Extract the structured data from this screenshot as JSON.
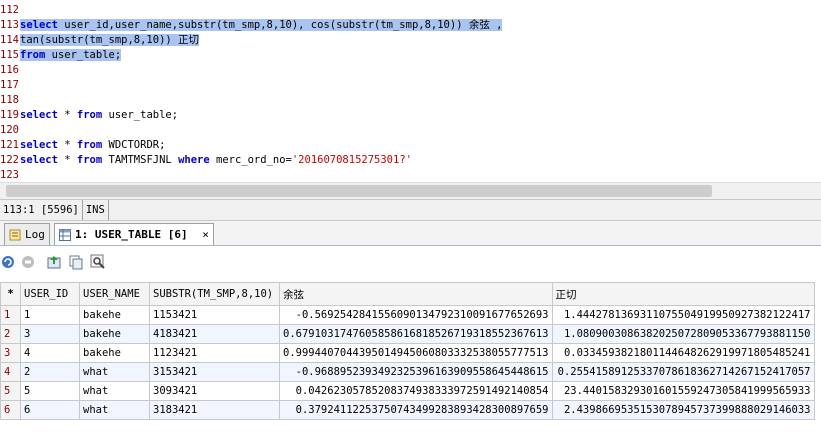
{
  "editor": {
    "lines": [
      {
        "num": "112",
        "parts": []
      },
      {
        "num": "113",
        "sel": true,
        "parts": [
          {
            "t": "kw",
            "v": "select"
          },
          {
            "t": "tx",
            "v": " user_id,user_name,substr(tm_smp,8,10), cos(substr(tm_smp,8,10)) 余弦 ,"
          }
        ]
      },
      {
        "num": "114",
        "sel": true,
        "parts": [
          {
            "t": "tx",
            "v": "tan(substr(tm_smp,8,10)) 正切"
          }
        ]
      },
      {
        "num": "115",
        "sel": true,
        "parts": [
          {
            "t": "kw",
            "v": "from"
          },
          {
            "t": "tx",
            "v": " user_table;"
          }
        ]
      },
      {
        "num": "116",
        "parts": []
      },
      {
        "num": "117",
        "parts": []
      },
      {
        "num": "118",
        "parts": []
      },
      {
        "num": "119",
        "parts": [
          {
            "t": "kw",
            "v": "select"
          },
          {
            "t": "tx",
            "v": " * "
          },
          {
            "t": "kw",
            "v": "from"
          },
          {
            "t": "tx",
            "v": " user_table;"
          }
        ]
      },
      {
        "num": "120",
        "parts": []
      },
      {
        "num": "121",
        "parts": [
          {
            "t": "kw",
            "v": "select"
          },
          {
            "t": "tx",
            "v": " * "
          },
          {
            "t": "kw",
            "v": "from"
          },
          {
            "t": "tx",
            "v": " WDCTORDR;"
          }
        ]
      },
      {
        "num": "122",
        "parts": [
          {
            "t": "kw",
            "v": "select"
          },
          {
            "t": "tx",
            "v": " * "
          },
          {
            "t": "kw",
            "v": "from"
          },
          {
            "t": "tx",
            "v": " TAMTMSFJNL "
          },
          {
            "t": "kw",
            "v": "where"
          },
          {
            "t": "tx",
            "v": " merc_ord_no="
          },
          {
            "t": "str",
            "v": "'2016070815275301?'"
          }
        ]
      },
      {
        "num": "123",
        "parts": []
      }
    ]
  },
  "status": {
    "position": "113:1 [5596]",
    "mode": "INS"
  },
  "tabs": {
    "log": "Log",
    "result": "1: USER_TABLE [6]",
    "close": "×"
  },
  "grid": {
    "star": "*",
    "headers": [
      "USER_ID",
      "USER_NAME",
      "SUBSTR(TM_SMP,8,10)",
      "余弦",
      "正切"
    ],
    "rows": [
      {
        "n": "1",
        "c": [
          "1",
          "bakehe",
          "1153421",
          "-0.5692542841556090134792310091677652693",
          "1.4442781369311075504919950927382122417"
        ]
      },
      {
        "n": "2",
        "c": [
          "3",
          "bakehe",
          "4183421",
          "0.6791031747605858616818526719318552367613",
          "1.0809003086382025072809053367793881150"
        ]
      },
      {
        "n": "3",
        "c": [
          "4",
          "bakehe",
          "1123421",
          "0.9994407044395014945060803332538055777513",
          "0.0334593821801144648262919971805485241"
        ]
      },
      {
        "n": "4",
        "c": [
          "2",
          "what",
          "3153421",
          "-0.9688952393492325396163909558645448615",
          "0.25541589125337078618362714267152417057"
        ]
      },
      {
        "n": "5",
        "c": [
          "5",
          "what",
          "3093421",
          "0.04262305785208374938333972591492140854",
          "23.440158329301601559247305841999565933"
        ]
      },
      {
        "n": "6",
        "c": [
          "6",
          "what",
          "3183421",
          "0.37924112253750743499283893428300897659",
          "2.4398669535153078945737399888029146033"
        ]
      }
    ]
  }
}
